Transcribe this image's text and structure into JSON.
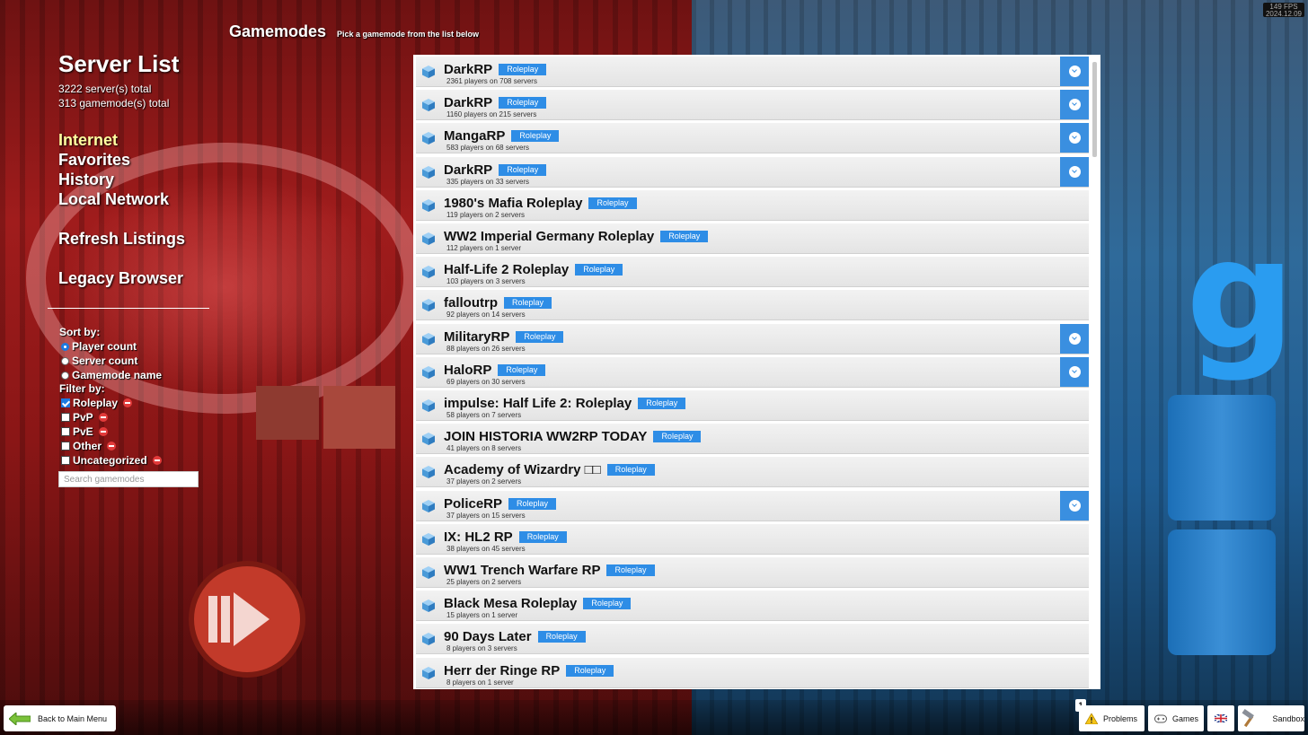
{
  "header": {
    "title": "Gamemodes",
    "subtitle": "Pick a gamemode from the list below",
    "fps": "149 FPS",
    "date": "2024.12.09"
  },
  "sidebar": {
    "title": "Server List",
    "server_total": "3222 server(s) total",
    "gamemode_total": "313 gamemode(s) total",
    "nav": [
      {
        "label": "Internet",
        "active": true
      },
      {
        "label": "Favorites"
      },
      {
        "label": "History"
      },
      {
        "label": "Local Network"
      },
      {
        "label": "Refresh Listings"
      },
      {
        "label": "Legacy Browser"
      }
    ],
    "sort_label": "Sort by:",
    "sort_options": [
      {
        "label": "Player count",
        "selected": true
      },
      {
        "label": "Server count"
      },
      {
        "label": "Gamemode name"
      }
    ],
    "filter_label": "Filter by:",
    "filters": [
      {
        "label": "Roleplay",
        "checked": true
      },
      {
        "label": "PvP"
      },
      {
        "label": "PvE"
      },
      {
        "label": "Other"
      },
      {
        "label": "Uncategorized"
      }
    ],
    "search_placeholder": "Search gamemodes"
  },
  "gamemodes": [
    {
      "name": "DarkRP",
      "tag": "Roleplay",
      "info": "2361 players on 708 servers",
      "download": true
    },
    {
      "name": "DarkRP",
      "tag": "Roleplay",
      "info": "1160 players on 215 servers",
      "download": true
    },
    {
      "name": "MangaRP",
      "tag": "Roleplay",
      "info": "583 players on 68 servers",
      "download": true
    },
    {
      "name": "DarkRP",
      "tag": "Roleplay",
      "info": "335 players on 33 servers",
      "download": true
    },
    {
      "name": "1980's Mafia Roleplay",
      "tag": "Roleplay",
      "info": "119 players on 2 servers"
    },
    {
      "name": "WW2 Imperial Germany Roleplay",
      "tag": "Roleplay",
      "info": "112 players on 1 server"
    },
    {
      "name": "Half-Life 2 Roleplay",
      "tag": "Roleplay",
      "info": "103 players on 3 servers"
    },
    {
      "name": "falloutrp",
      "tag": "Roleplay",
      "info": "92 players on 14 servers"
    },
    {
      "name": "MilitaryRP",
      "tag": "Roleplay",
      "info": "88 players on 26 servers",
      "download": true
    },
    {
      "name": "HaloRP",
      "tag": "Roleplay",
      "info": "69 players on 30 servers",
      "download": true
    },
    {
      "name": "impulse: Half Life 2: Roleplay",
      "tag": "Roleplay",
      "info": "58 players on 7 servers"
    },
    {
      "name": "JOIN HISTORIA WW2RP TODAY",
      "tag": "Roleplay",
      "info": "41 players on 8 servers"
    },
    {
      "name": "Academy of Wizardry □□",
      "tag": "Roleplay",
      "info": "37 players on 2 servers"
    },
    {
      "name": "PoliceRP",
      "tag": "Roleplay",
      "info": "37 players on 15 servers",
      "download": true
    },
    {
      "name": "IX: HL2 RP",
      "tag": "Roleplay",
      "info": "38 players on 45 servers"
    },
    {
      "name": "WW1 Trench Warfare RP",
      "tag": "Roleplay",
      "info": "25 players on 2 servers"
    },
    {
      "name": "Black Mesa Roleplay",
      "tag": "Roleplay",
      "info": "15 players on 1 server"
    },
    {
      "name": "90 Days Later",
      "tag": "Roleplay",
      "info": "8 players on 3 servers"
    },
    {
      "name": "Herr der Ringe RP",
      "tag": "Roleplay",
      "info": "8 players on 1 server"
    }
  ],
  "footer": {
    "back_label": "Back to Main Menu",
    "problems_badge": "1",
    "problems_label": "Problems",
    "games_label": "Games",
    "sandbox_label": "Sandbox"
  },
  "colors": {
    "accent": "#2e8de6",
    "active_nav": "#ffffa0",
    "left_bg": "#a01c1c",
    "right_bg": "#2f6a9a"
  }
}
